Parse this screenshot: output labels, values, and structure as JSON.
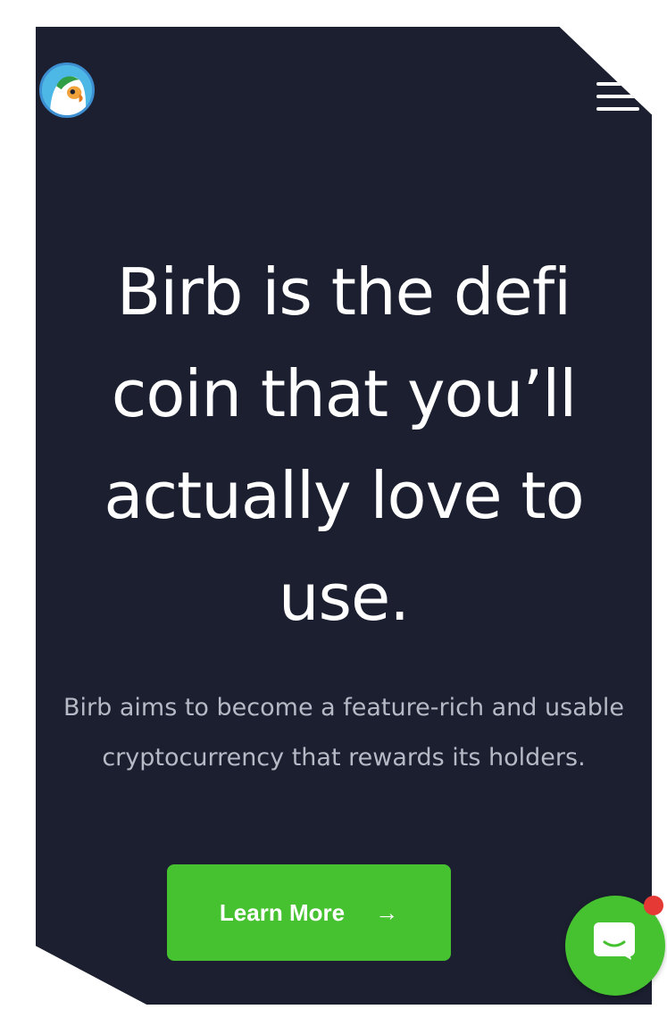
{
  "header": {
    "logo_alt": "Birb logo",
    "menu_icon": "hamburger-menu-icon"
  },
  "hero": {
    "title": "Birb is the defi coin that you’ll actually love to use.",
    "subtitle": "Birb aims to become a feature-rich and usable cryptocurrency that rewards its holders.",
    "cta_label": "Learn More",
    "cta_icon": "arrow-right-icon"
  },
  "chat_widget": {
    "icon": "chat-bubble-icon",
    "has_notification": true
  },
  "colors": {
    "background": "#1b1f2f",
    "accent": "#46c231",
    "title_text": "#ffffff",
    "subtitle_text": "#b5bac6",
    "notification": "#e53935"
  }
}
